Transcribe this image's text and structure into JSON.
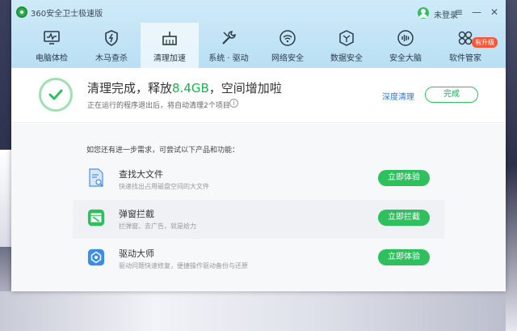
{
  "window": {
    "title": "360安全卫士极速版",
    "login_text": "未登录",
    "controls": [
      "≡",
      "—",
      "✕"
    ]
  },
  "nav": {
    "items": [
      {
        "label": "电脑体检",
        "icon": "monitor-icon"
      },
      {
        "label": "木马查杀",
        "icon": "shield-icon"
      },
      {
        "label": "清理加速",
        "icon": "broom-icon",
        "active": true
      },
      {
        "label": "系统 · 驱动",
        "icon": "wrench-icon"
      },
      {
        "label": "网络安全",
        "icon": "wifi-icon"
      },
      {
        "label": "数据安全",
        "icon": "cube-icon"
      },
      {
        "label": "安全大脑",
        "icon": "voice-wave-icon"
      },
      {
        "label": "软件管家",
        "icon": "apps-icon"
      }
    ],
    "upgrade_badge": "有升级"
  },
  "status": {
    "title_prefix": "清理完成，释放",
    "title_amount": "8.4GB",
    "title_suffix": "，空间增加啦",
    "subtitle": "正在运行的程序退出后，将自动清理2个项目",
    "info_icon": "i",
    "deep_clean_link": "深度清理",
    "done_button": "完成"
  },
  "suggestions": {
    "hint": "如您还有进一步需求，可尝试以下产品和功能：",
    "items": [
      {
        "title": "查找大文件",
        "desc": "快速找出占用磁盘空间的大文件",
        "button": "立即体验",
        "icon": "file-search-icon"
      },
      {
        "title": "弹窗拦截",
        "desc": "拦弹窗、去广告，就是给力",
        "button": "立即拦截",
        "icon": "popup-block-icon"
      },
      {
        "title": "驱动大师",
        "desc": "驱动问题快速修复，便捷操作驱动备份与还原",
        "button": "立即体验",
        "icon": "driver-icon"
      }
    ]
  },
  "colors": {
    "accent_green": "#2fbf5f",
    "highlight_green": "#1eaf4f",
    "link_blue": "#2b7bd6",
    "badge_red": "#f25a3a"
  }
}
